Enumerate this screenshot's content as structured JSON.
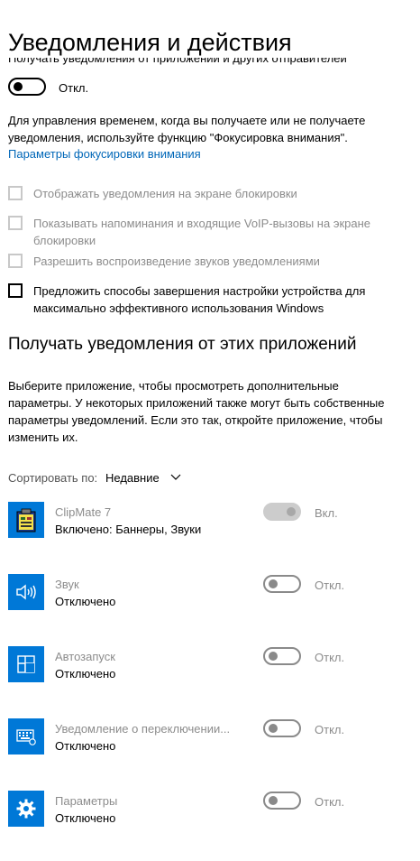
{
  "header": {
    "title": "Уведомления и действия"
  },
  "notifications": {
    "label": "Получать уведомления от приложений и других отправителей",
    "toggle_state": "Откл."
  },
  "focus": {
    "description": "Для управления временем, когда вы получаете или не получаете уведомления, используйте функцию \"Фокусировка внимания\".",
    "link": "Параметры фокусировки внимания"
  },
  "checkboxes": [
    {
      "label": "Отображать уведомления на экране блокировки",
      "enabled": false,
      "checked": false
    },
    {
      "label": "Показывать напоминания и входящие VoIP-вызовы на экране блокировки",
      "enabled": false,
      "checked": false
    },
    {
      "label": "Разрешить  воспроизведение звуков уведомлениями",
      "enabled": false,
      "checked": false
    },
    {
      "label": "Предложить способы завершения настройки устройства для максимально эффективного использования Windows",
      "enabled": true,
      "checked": false
    }
  ],
  "apps_section": {
    "title": "Получать уведомления от этих приложений",
    "description": "Выберите приложение, чтобы просмотреть дополнительные параметры. У некоторых приложений также могут быть собственные параметры уведомлений. Если это так, откройте приложение, чтобы изменить их.",
    "sort_label": "Сортировать по:",
    "sort_value": "Недавние"
  },
  "apps": [
    {
      "name": "ClipMate 7",
      "status": "Включено: Баннеры, Звуки",
      "toggle": "Вкл.",
      "on": true,
      "icon": "clipmate-icon"
    },
    {
      "name": "Звук",
      "status": "Отключено",
      "toggle": "Откл.",
      "on": false,
      "icon": "speaker-icon"
    },
    {
      "name": "Автозапуск",
      "status": "Отключено",
      "toggle": "Откл.",
      "on": false,
      "icon": "autoplay-icon"
    },
    {
      "name": "Уведомление о переключении...",
      "status": "Отключено",
      "toggle": "Откл.",
      "on": false,
      "icon": "keyboard-icon"
    },
    {
      "name": "Параметры",
      "status": "Отключено",
      "toggle": "Откл.",
      "on": false,
      "icon": "gear-icon"
    }
  ],
  "colors": {
    "accent": "#0067b8",
    "icon_bg": "#0078d7"
  }
}
